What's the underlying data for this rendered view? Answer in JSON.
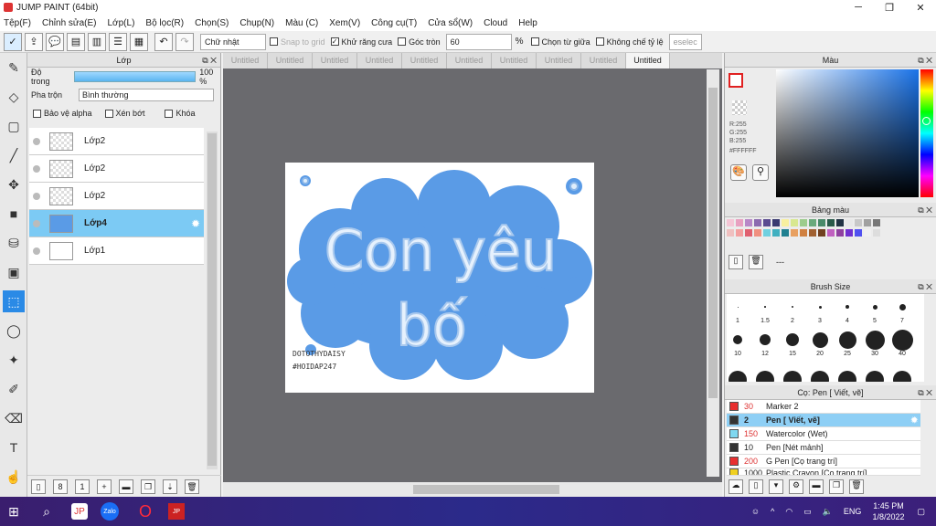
{
  "window": {
    "title": "JUMP PAINT (64bit)"
  },
  "menu": [
    "Tệp(F)",
    "Chỉnh sửa(E)",
    "Lớp(L)",
    "Bộ lọc(R)",
    "Chọn(S)",
    "Chụp(N)",
    "Màu (C)",
    "Xem(V)",
    "Công cụ(T)",
    "Cửa sổ(W)",
    "Cloud",
    "Help"
  ],
  "toolbar": {
    "selection_mode": "Chữ nhật",
    "snap_to_grid": "Snap to grid",
    "antialias": "Khử răng cưa",
    "round_corner": "Góc tròn",
    "round_value": "60",
    "percent": "%",
    "select_middle": "Chọn từ giữa",
    "keep_ratio": "Không chế tỷ lệ",
    "deselect": "eselec"
  },
  "layer_panel": {
    "title": "Lớp",
    "opacity_label": "Độ trong",
    "opacity_value": "100 %",
    "blend_label": "Pha trộn",
    "blend_value": "Bình thường",
    "protect_alpha": "Bảo vệ alpha",
    "clipping": "Xén bớt",
    "lock": "Khóa",
    "layers": [
      {
        "name": "Lớp2",
        "thumb": "checker"
      },
      {
        "name": "Lớp2",
        "thumb": "checker"
      },
      {
        "name": "Lớp2",
        "thumb": "checker"
      },
      {
        "name": "Lớp4",
        "thumb": "blue",
        "selected": true
      },
      {
        "name": "Lớp1",
        "thumb": "white"
      }
    ]
  },
  "doc_tabs": [
    "Untitled",
    "Untitled",
    "Untitled",
    "Untitled",
    "Untitled",
    "Untitled",
    "Untitled",
    "Untitled",
    "Untitled",
    "Untitled"
  ],
  "canvas": {
    "line1": "Con yêu",
    "line2": "bố",
    "sign1": "DOTOTHYDAISY",
    "sign2": "#HOIDAP247"
  },
  "color_panel": {
    "title": "Màu",
    "r": "R:255",
    "g": "G:255",
    "b": "B:255",
    "hex": "#FFFFFF"
  },
  "palette_panel": {
    "title": "Bảng màu",
    "extra": "---"
  },
  "brush_size_panel": {
    "title": "Brush Size",
    "sizes": [
      "1",
      "1.5",
      "2",
      "3",
      "4",
      "5",
      "7",
      "10",
      "12",
      "15",
      "20",
      "25",
      "30",
      "40"
    ]
  },
  "brush_panel": {
    "title": "Cọ: Pen [ Viết, vẽ]",
    "brushes": [
      {
        "size": "30",
        "name": "Marker 2",
        "color": "#e83030"
      },
      {
        "size": "2",
        "name": "Pen [ Viết, vẽ]",
        "color": "#333333",
        "selected": true
      },
      {
        "size": "150",
        "name": "Watercolor (Wet)",
        "color": "#7fd8f0"
      },
      {
        "size": "10",
        "name": "Pen [Nét mảnh]",
        "color": "#333333"
      },
      {
        "size": "200",
        "name": "G Pen [Cọ trang trí]",
        "color": "#e83030"
      },
      {
        "size": "1000",
        "name": "Plastic Crayon [Cọ trang trí]",
        "color": "#f0d020"
      }
    ]
  },
  "taskbar": {
    "lang": "ENG",
    "time": "1:45 PM",
    "date": "1/8/2022"
  },
  "colors": {
    "accent": "#2a8ae6",
    "canvas_blue": "#5a9be6",
    "letter": "#dfeefc"
  }
}
